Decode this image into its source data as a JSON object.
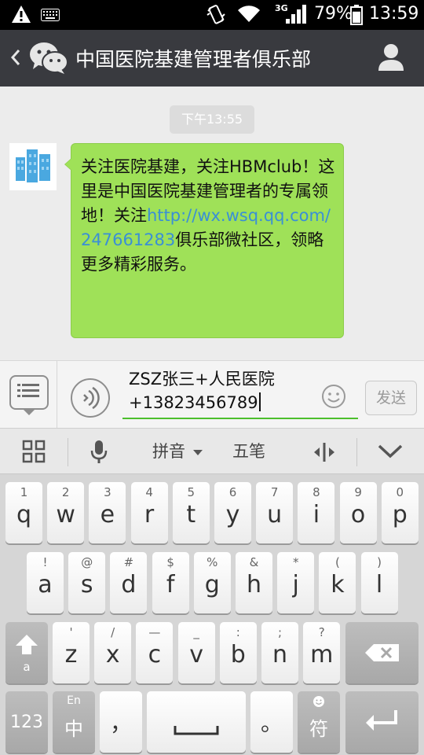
{
  "status_bar": {
    "network": "3G",
    "battery_percent": "79%",
    "battery_level": 0.79,
    "time": "13:59"
  },
  "header": {
    "title": "中国医院基建管理者俱乐部"
  },
  "chat": {
    "timestamp": "下午13:55",
    "message": {
      "text_before_link": "关注医院基建，关注HBMclub！这里是中国医院基建管理者的专属领地！关注",
      "link": "http://wx.wsq.qq.com/247661283",
      "text_after_link": "俱乐部微社区，领略更多精彩服务。"
    }
  },
  "input": {
    "value": "ZSZ张三+人民医院+13823456789",
    "send_label": "发送"
  },
  "ime_toolbar": {
    "pinyin": "拼音",
    "wubi": "五笔"
  },
  "keyboard": {
    "row1": [
      {
        "hint": "1",
        "key": "q"
      },
      {
        "hint": "2",
        "key": "w"
      },
      {
        "hint": "3",
        "key": "e"
      },
      {
        "hint": "4",
        "key": "r"
      },
      {
        "hint": "5",
        "key": "t"
      },
      {
        "hint": "6",
        "key": "y"
      },
      {
        "hint": "7",
        "key": "u"
      },
      {
        "hint": "8",
        "key": "i"
      },
      {
        "hint": "9",
        "key": "o"
      },
      {
        "hint": "0",
        "key": "p"
      }
    ],
    "row2": [
      {
        "hint": "!",
        "key": "a"
      },
      {
        "hint": "@",
        "key": "s"
      },
      {
        "hint": "#",
        "key": "d"
      },
      {
        "hint": "$",
        "key": "f"
      },
      {
        "hint": "%",
        "key": "g"
      },
      {
        "hint": "&",
        "key": "h"
      },
      {
        "hint": "*",
        "key": "j"
      },
      {
        "hint": "(",
        "key": "k"
      },
      {
        "hint": ")",
        "key": "l"
      }
    ],
    "row3": [
      {
        "hint": "'",
        "key": "z"
      },
      {
        "hint": "/",
        "key": "x"
      },
      {
        "hint": "—",
        "key": "c"
      },
      {
        "hint": "_",
        "key": "v"
      },
      {
        "hint": ":",
        "key": "b"
      },
      {
        "hint": ";",
        "key": "n"
      },
      {
        "hint": "?",
        "key": "m"
      }
    ],
    "shift_label": "a",
    "numbers_label": "123",
    "lang_hint": "En",
    "lang_label": "中",
    "comma_label": "，",
    "period_label": "。",
    "symbol_label": "符"
  }
}
